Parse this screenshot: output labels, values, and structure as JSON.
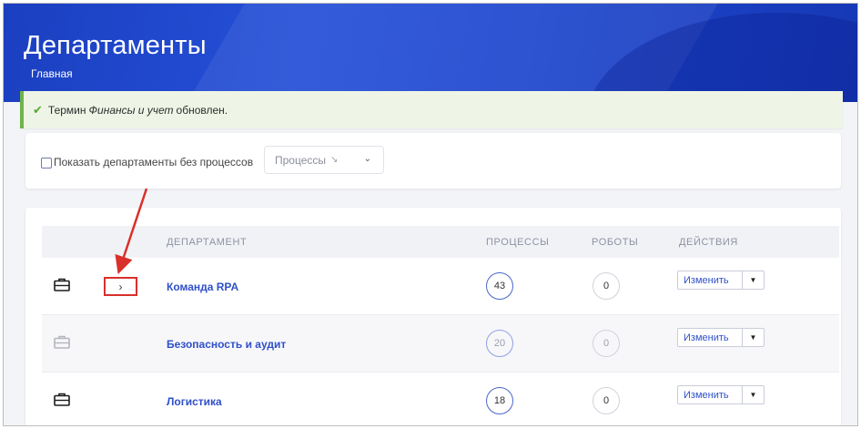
{
  "header": {
    "title": "Департаменты",
    "breadcrumb": "Главная"
  },
  "alert": {
    "prefix": "Термин",
    "term": "Финансы и учет",
    "suffix": "обновлен.",
    "status_color": "#6fb34a"
  },
  "filters": {
    "checkbox_label": "Показать департаменты без процессов",
    "checkbox_checked": false,
    "sort_select_value": "Процессы"
  },
  "table": {
    "columns": [
      "ДЕПАРТАМЕНТ",
      "ПРОЦЕССЫ",
      "РОБОТЫ",
      "ДЕЙСТВИЯ"
    ],
    "rows": [
      {
        "name": "Команда RPA",
        "processes": "43",
        "robots": "0",
        "action": "Изменить",
        "expandable": true,
        "muted": false
      },
      {
        "name": "Безопасность и аудит",
        "processes": "20",
        "robots": "0",
        "action": "Изменить",
        "expandable": false,
        "muted": true
      },
      {
        "name": "Логистика",
        "processes": "18",
        "robots": "0",
        "action": "Изменить",
        "expandable": false,
        "muted": false
      }
    ],
    "expand_glyph": "›"
  },
  "colors": {
    "accent": "#2f50c9",
    "hero": "#1f47cf",
    "highlight": "#d9302b"
  }
}
